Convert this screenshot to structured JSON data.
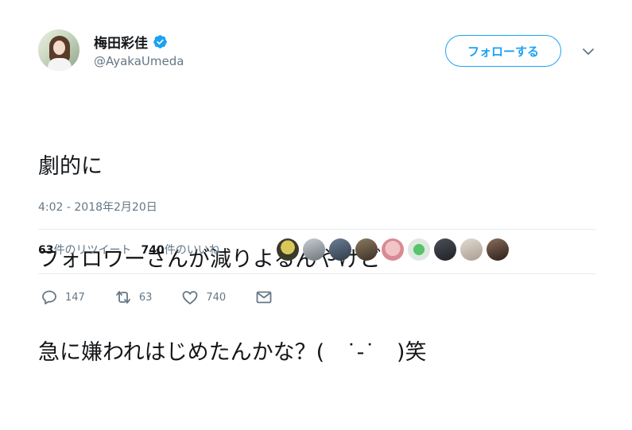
{
  "user": {
    "display_name": "梅田彩佳",
    "handle": "@AyakaUmeda",
    "verified": true
  },
  "follow_button": {
    "label": "フォローする"
  },
  "tweet": {
    "lines": [
      "劇的に",
      "フォロワーさんが減りよるんやけど",
      "急に嫌われはじめたんかな？(　˙-˙　)笑"
    ],
    "timestamp": "4:02 - 2018年2月20日"
  },
  "stats": {
    "retweets_count": "63",
    "retweets_label": "件のリツイート",
    "likes_count": "740",
    "likes_label": "件のいいね"
  },
  "actions": {
    "reply_count": "147",
    "retweet_count": "63",
    "like_count": "740"
  },
  "colors": {
    "accent": "#1da1f2",
    "muted": "#657786",
    "text": "#14171a"
  },
  "icons": [
    "verified-badge-icon",
    "chevron-down-icon",
    "reply-icon",
    "retweet-icon",
    "like-icon",
    "direct-message-icon"
  ]
}
